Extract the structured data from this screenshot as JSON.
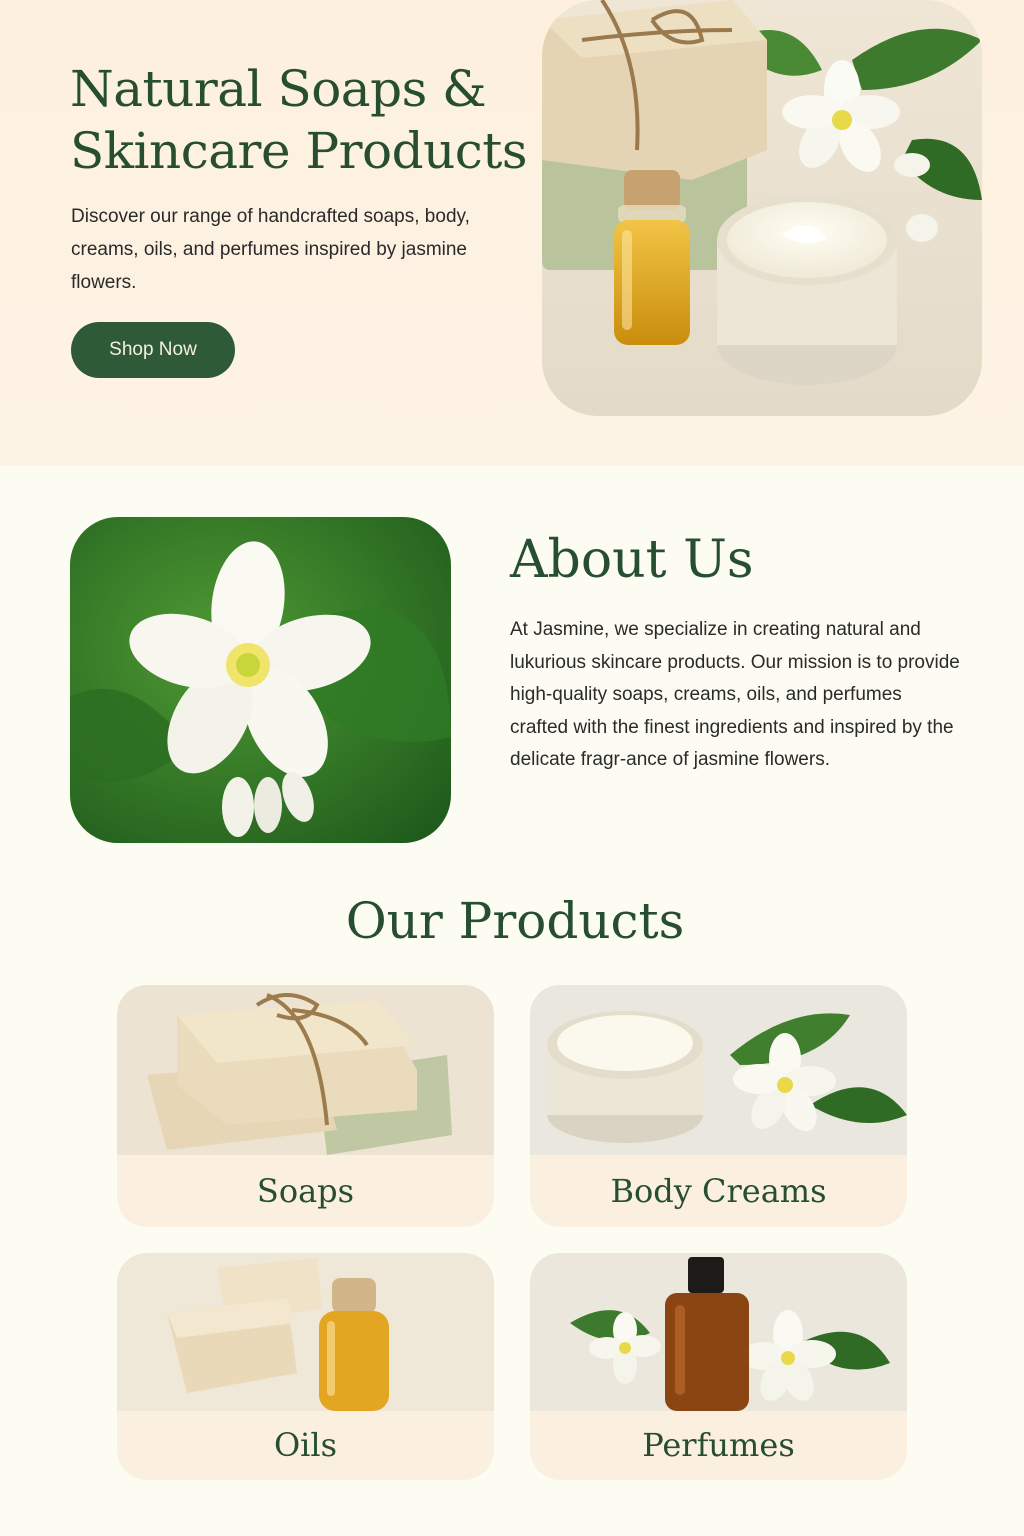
{
  "hero": {
    "title": "Natural Soaps & Skincare Products",
    "description": "Discover our range of handcrafted soaps, body, creams, oils, and perfumes inspired by jasmine flowers.",
    "cta_label": "Shop Now",
    "image": "soap-cream-oil-jasmine-photo"
  },
  "about": {
    "title": "About Us",
    "text": "At Jasmine, we specialize in creating natural and lukurious skincare products. Our mission is to provide high-quality soaps, creams, oils, and perfumes crafted with the finest ingredients and inspired by the delicate fragr-ance of jasmine flowers.",
    "image": "jasmine-flower-photo"
  },
  "products": {
    "title": "Our Products",
    "items": [
      {
        "label": "Soaps",
        "image": "soap-bars-photo"
      },
      {
        "label": "Body Creams",
        "image": "cream-jar-photo"
      },
      {
        "label": "Oils",
        "image": "oil-bottle-photo"
      },
      {
        "label": "Perfumes",
        "image": "perfume-bottle-photo"
      }
    ]
  },
  "colors": {
    "brand_green": "#274e31",
    "button_green": "#2f5a38",
    "hero_bg": "#fdf0de",
    "page_bg": "#fdfcf3",
    "card_bg": "#fbf0e0"
  }
}
